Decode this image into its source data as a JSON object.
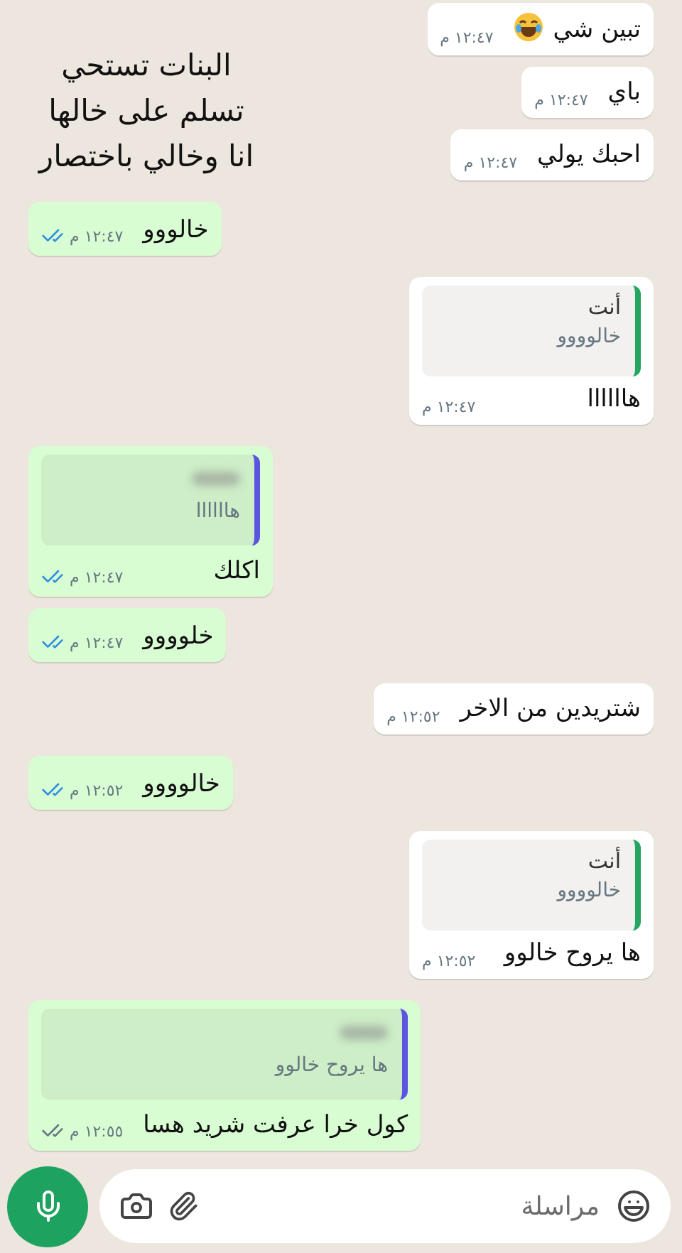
{
  "caption": {
    "lines": [
      "البنات تستحي",
      "تسلم على خالها",
      "انا وخالي باختصار"
    ]
  },
  "messages": [
    {
      "kind": "incoming",
      "text": "تبين شي",
      "emoji": true,
      "time": "١٢:٤٧ م"
    },
    {
      "kind": "incoming",
      "text": "باي",
      "time": "١٢:٤٧ م"
    },
    {
      "kind": "incoming",
      "text": "احبك يولي",
      "time": "١٢:٤٧ م"
    },
    {
      "kind": "outgoing",
      "text": "خالووو",
      "time": "١٢:٤٧ م",
      "read": true
    },
    {
      "kind": "incoming",
      "quote": {
        "author": "أنت",
        "author_hidden": false,
        "text": "خالوووو",
        "color": "#25a562"
      },
      "text": "هاااااا",
      "time": "١٢:٤٧ م"
    },
    {
      "kind": "outgoing",
      "quote": {
        "author_hidden": true,
        "text": "هاااااا",
        "color": "#5b55e0"
      },
      "text": "اكلك",
      "time": "١٢:٤٧ م",
      "read": true
    },
    {
      "kind": "outgoing",
      "text": "خلوووو",
      "time": "١٢:٤٧ م",
      "read": true
    },
    {
      "kind": "incoming",
      "text": "شتريدين من الاخر",
      "time": "١٢:٥٢ م"
    },
    {
      "kind": "outgoing",
      "text": "خالوووو",
      "time": "١٢:٥٢ م",
      "read": true
    },
    {
      "kind": "incoming",
      "quote": {
        "author": "أنت",
        "author_hidden": false,
        "text": "خالوووو",
        "color": "#25a562"
      },
      "text": "ها يروح خالوو",
      "time": "١٢:٥٢ م"
    },
    {
      "kind": "outgoing",
      "quote": {
        "author_hidden": true,
        "text": "ها يروح خالوو",
        "color": "#5b55e0"
      },
      "text": "كول خرا عرفت شريد هسا",
      "time": "١٢:٥٥ م",
      "read": false
    }
  ],
  "composer": {
    "placeholder": "مراسلة"
  }
}
